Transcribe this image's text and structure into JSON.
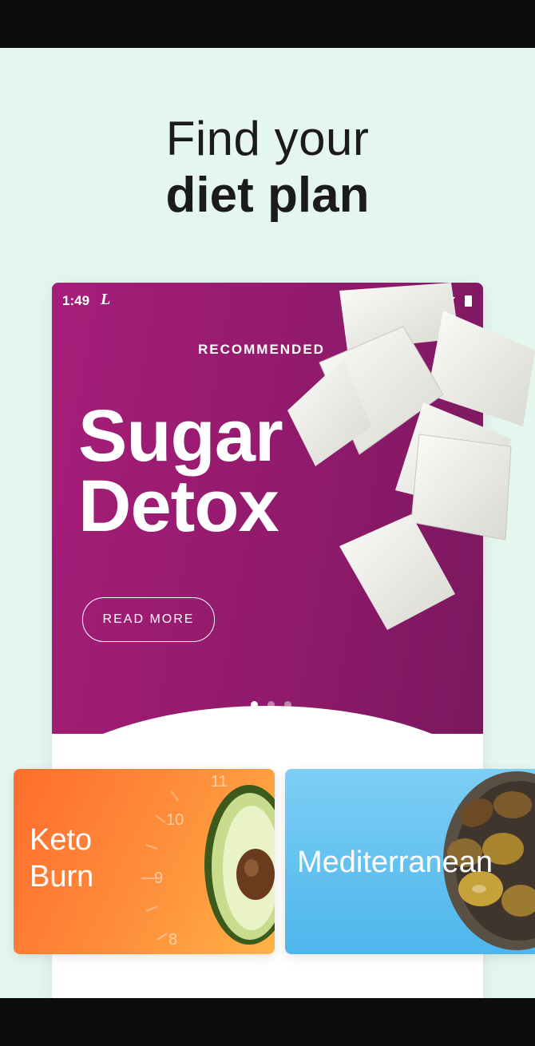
{
  "headline": {
    "line1": "Find your",
    "line2": "diet plan"
  },
  "phone": {
    "status": {
      "time": "1:49",
      "carrier_glyph": "L"
    },
    "hero": {
      "badge": "RECOMMENDED",
      "title_line1": "Sugar",
      "title_line2": "Detox",
      "cta": "READ MORE",
      "pager_count": 3,
      "pager_active": 1
    }
  },
  "cards": {
    "keto": {
      "line1": "Keto",
      "line2": "Burn",
      "clock": [
        "11",
        "10",
        "9",
        "8"
      ]
    },
    "mediterranean": {
      "label": "Mediterranean"
    }
  },
  "colors": {
    "background": "#e4f6ee",
    "hero": "#911a6c",
    "keto": "#ff8c3a",
    "mediterranean": "#4eb6ec"
  }
}
